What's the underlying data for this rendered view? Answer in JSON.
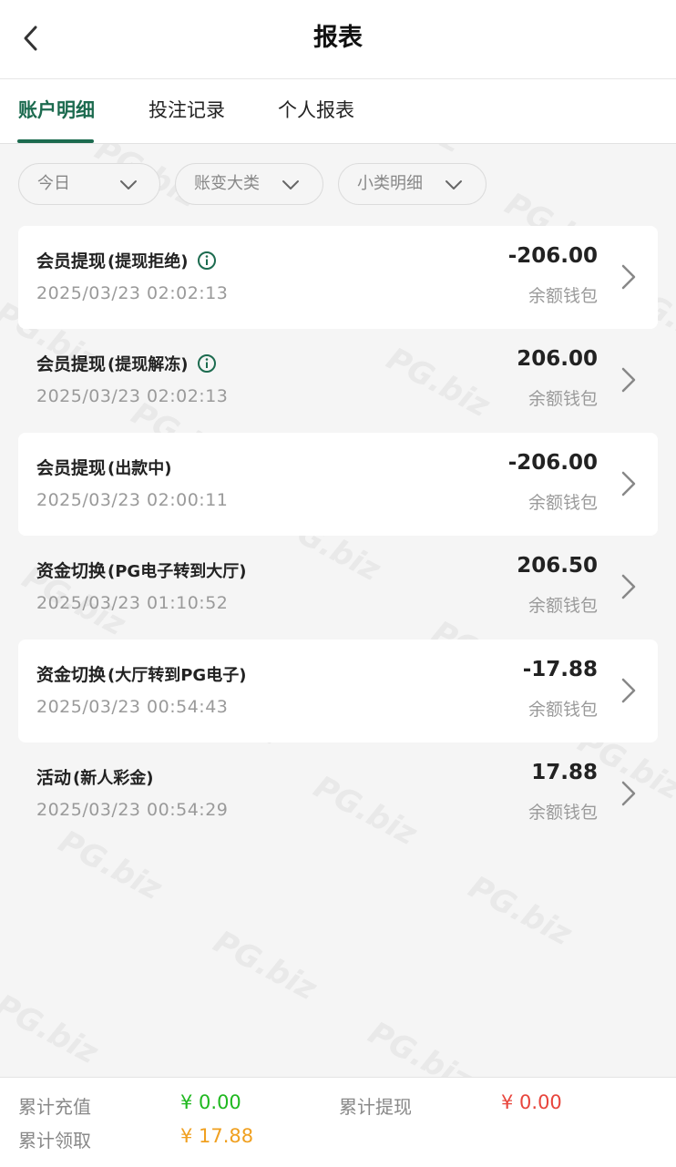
{
  "header": {
    "title": "报表",
    "back_icon": "chevron-left-icon"
  },
  "tabs": [
    {
      "label": "账户明细",
      "active": true
    },
    {
      "label": "投注记录",
      "active": false
    },
    {
      "label": "个人报表",
      "active": false
    }
  ],
  "filters": [
    {
      "label": "今日",
      "icon": "chevron-down-icon"
    },
    {
      "label": "账变大类",
      "icon": "chevron-down-icon"
    },
    {
      "label": "小类明细",
      "icon": "chevron-down-icon"
    }
  ],
  "records": [
    {
      "title": "会员提现",
      "subtitle": "(提现拒绝)",
      "has_info": true,
      "date": "2025/03/23 02:02:13",
      "amount": "-206.00",
      "wallet": "余额钱包"
    },
    {
      "title": "会员提现",
      "subtitle": "(提现解冻)",
      "has_info": true,
      "date": "2025/03/23 02:02:13",
      "amount": "206.00",
      "wallet": "余额钱包"
    },
    {
      "title": "会员提现",
      "subtitle": "(出款中)",
      "has_info": false,
      "date": "2025/03/23 02:00:11",
      "amount": "-206.00",
      "wallet": "余额钱包"
    },
    {
      "title": "资金切换",
      "subtitle": "(PG电子转到大厅)",
      "has_info": false,
      "date": "2025/03/23 01:10:52",
      "amount": "206.50",
      "wallet": "余额钱包"
    },
    {
      "title": "资金切换",
      "subtitle": "(大厅转到PG电子)",
      "has_info": false,
      "date": "2025/03/23 00:54:43",
      "amount": "-17.88",
      "wallet": "余额钱包"
    },
    {
      "title": "活动",
      "subtitle": "(新人彩金)",
      "has_info": false,
      "date": "2025/03/23 00:54:29",
      "amount": "17.88",
      "wallet": "余额钱包"
    }
  ],
  "summary": {
    "recharge_label": "累计充值",
    "recharge_value": "¥ 0.00",
    "withdraw_label": "累计提现",
    "withdraw_value": "¥ 0.00",
    "claim_label": "累计领取",
    "claim_value": "¥ 17.88"
  },
  "colors": {
    "accent": "#1c6b4f",
    "recharge": "#1fb81f",
    "withdraw": "#e8453c",
    "claim": "#f0a020"
  },
  "watermark": "PG.biz"
}
